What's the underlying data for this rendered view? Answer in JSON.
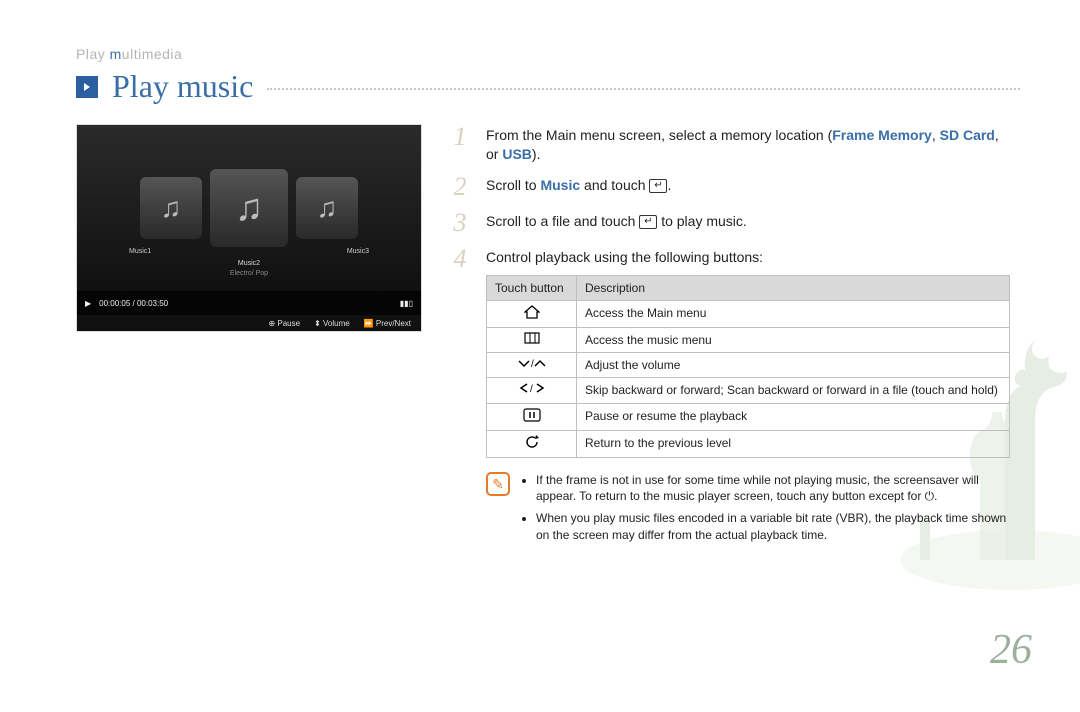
{
  "breadcrumb": {
    "full": "Play multimedia",
    "hi_char": "m"
  },
  "title": "Play music",
  "screenshot": {
    "tile_left": "Music1",
    "tile_center": "Music2",
    "tile_right": "Music3",
    "artist": "Electro/ Pop",
    "time": "00:00:05 / 00:03:50",
    "hint_pause": "Pause",
    "hint_volume": "Volume",
    "hint_prevnext": "Prev/Next"
  },
  "steps": {
    "s1": {
      "num": "1",
      "before": "From the Main menu screen, select a memory location (",
      "hl1": "Frame Memory",
      "sep1": ", ",
      "hl2": "SD Card",
      "sep2": ", or ",
      "hl3": "USB",
      "after": ")."
    },
    "s2": {
      "num": "2",
      "before": "Scroll to ",
      "hl": "Music",
      "after": " and touch "
    },
    "s3": {
      "num": "3",
      "text_before": "Scroll to a file and touch ",
      "text_after": " to play music."
    },
    "s4": {
      "num": "4",
      "text": "Control playback using the following buttons:"
    }
  },
  "table": {
    "head1": "Touch button",
    "head2": "Description",
    "rows": [
      {
        "icon": "home-icon",
        "desc": "Access the Main menu"
      },
      {
        "icon": "grid-icon",
        "desc": "Access the music menu"
      },
      {
        "icon": "vol-icon",
        "desc": "Adjust the volume"
      },
      {
        "icon": "skip-icon",
        "desc": "Skip backward or forward; Scan backward or forward in a file (touch and hold)"
      },
      {
        "icon": "play-icon",
        "desc": "Pause or resume the playback"
      },
      {
        "icon": "back-icon",
        "desc": "Return to the previous level"
      }
    ]
  },
  "notes": [
    "If the frame is not in use for some time while not playing music, the screensaver will appear. To return to the music player screen, touch any button except for ⏻.",
    "When you play music files encoded in a variable bit rate (VBR), the playback time shown on the screen may differ from the actual playback time."
  ],
  "page_number": "26"
}
